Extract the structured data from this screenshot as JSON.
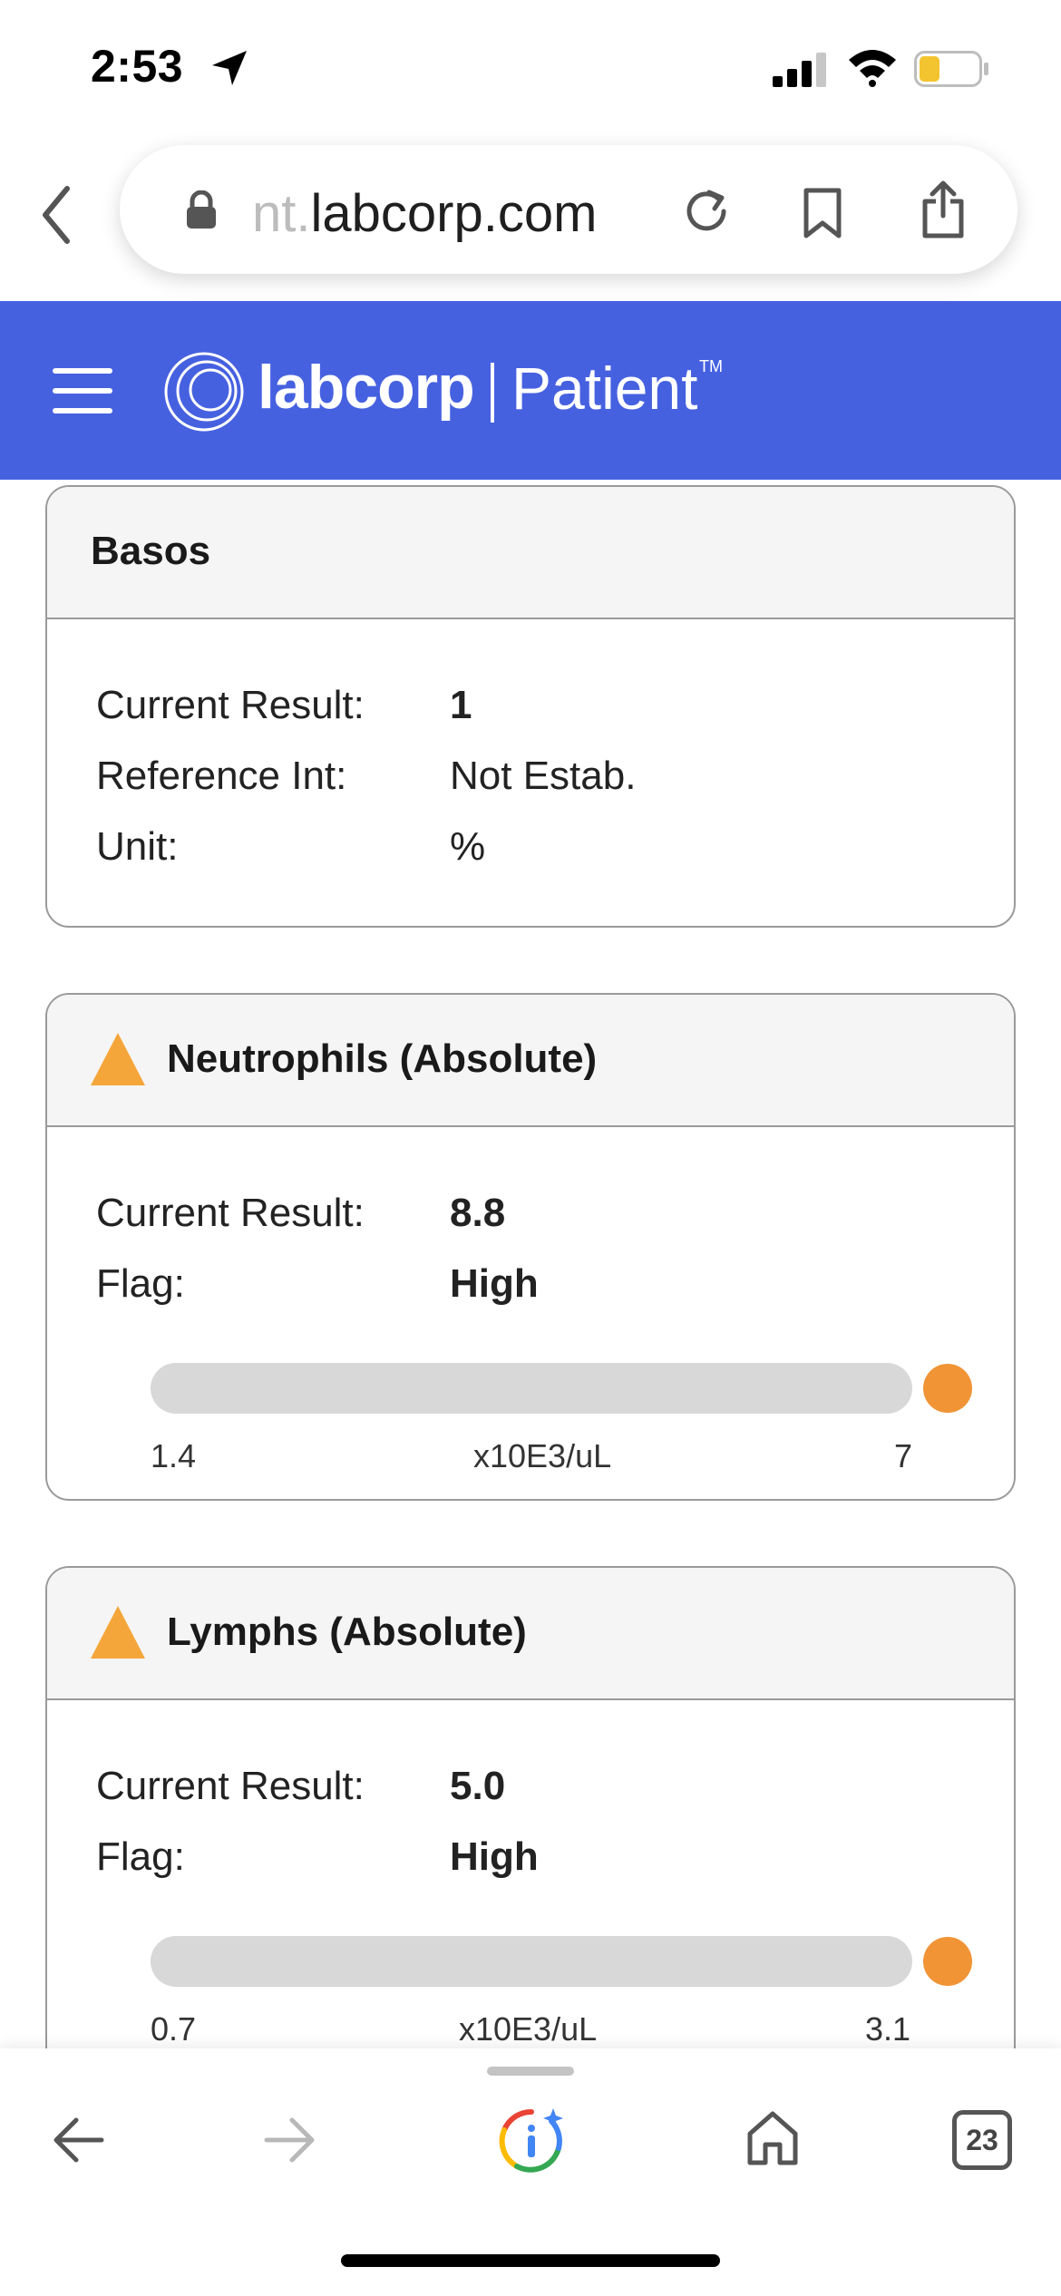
{
  "status_bar": {
    "time": "2:53",
    "battery_color": "#f4c430"
  },
  "browser": {
    "url_faded": "nt.",
    "url_main": "labcorp.com"
  },
  "header": {
    "brand": "labcorp",
    "brand_sub": "Patient",
    "trademark": "TM",
    "background_color": "#4661e0"
  },
  "cards": [
    {
      "title": "Basos",
      "flagged": false,
      "rows": [
        {
          "label": "Current Result:",
          "value": "1"
        },
        {
          "label": "Reference Int:",
          "value": "Not Estab."
        },
        {
          "label": "Unit:",
          "value": "%"
        }
      ]
    },
    {
      "title": "Neutrophils (Absolute)",
      "flagged": true,
      "rows": [
        {
          "label": "Current Result:",
          "value": "8.8"
        },
        {
          "label": "Flag:",
          "value": "High"
        }
      ],
      "range": {
        "low": "1.4",
        "unit": "x10E3/uL",
        "high": "7",
        "position": "above-high"
      }
    },
    {
      "title": "Lymphs (Absolute)",
      "flagged": true,
      "rows": [
        {
          "label": "Current Result:",
          "value": "5.0"
        },
        {
          "label": "Flag:",
          "value": "High"
        }
      ],
      "range": {
        "low": "0.7",
        "unit": "x10E3/uL",
        "high": "3.1",
        "position": "above-high"
      }
    }
  ],
  "colors": {
    "warning": "#f5a63a",
    "result_dot": "#f09436",
    "range_track": "#d8d8d8"
  },
  "toolbar": {
    "tab_count": "23"
  }
}
